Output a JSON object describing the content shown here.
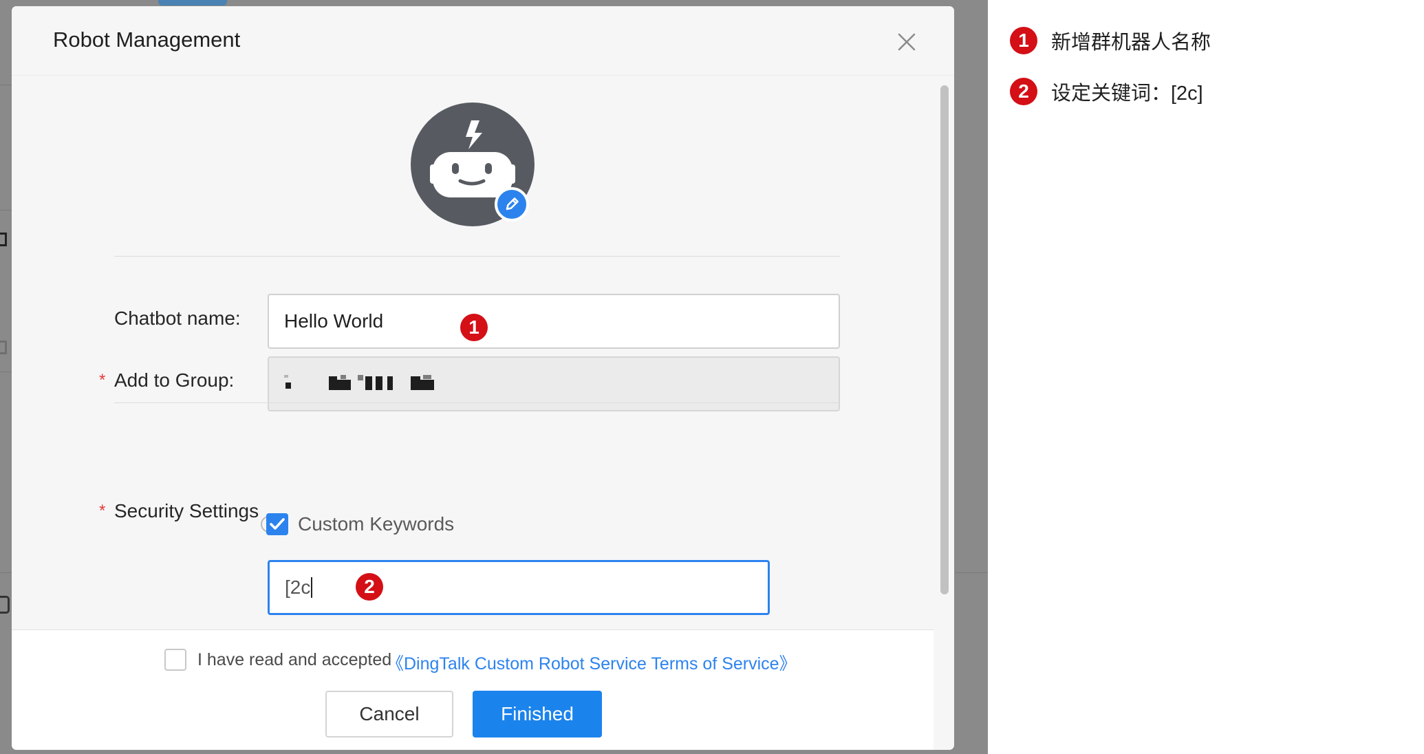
{
  "dialog": {
    "title": "Robot Management"
  },
  "form": {
    "chatbot_name": {
      "label": "Chatbot name:",
      "value": "Hello World"
    },
    "add_to_group": {
      "label": "Add to Group:",
      "required_mark": "*"
    },
    "security_settings": {
      "label": "Security Settings",
      "required_mark": "*",
      "custom_keywords_label": "Custom Keywords",
      "custom_keywords_checked": true,
      "keyword_value": "[2c"
    }
  },
  "footer": {
    "agree_text": "I have read and accepted",
    "terms_link": "《DingTalk Custom Robot Service Terms of Service》",
    "cancel_label": "Cancel",
    "finish_label": "Finished"
  },
  "annotations": {
    "marker_1": "1",
    "marker_2": "2"
  },
  "legend": [
    {
      "number": "1",
      "text": "新增群机器人名称"
    },
    {
      "number": "2",
      "text": "设定关键词：[2c]"
    }
  ],
  "colors": {
    "accent": "#1b83ec",
    "marker": "#d40f16",
    "avatar": "#575b61",
    "required": "#e53935"
  },
  "icons": {
    "close": "close-icon",
    "avatar": "robot-avatar-icon",
    "edit": "pencil-icon",
    "check": "checkmark-icon"
  }
}
